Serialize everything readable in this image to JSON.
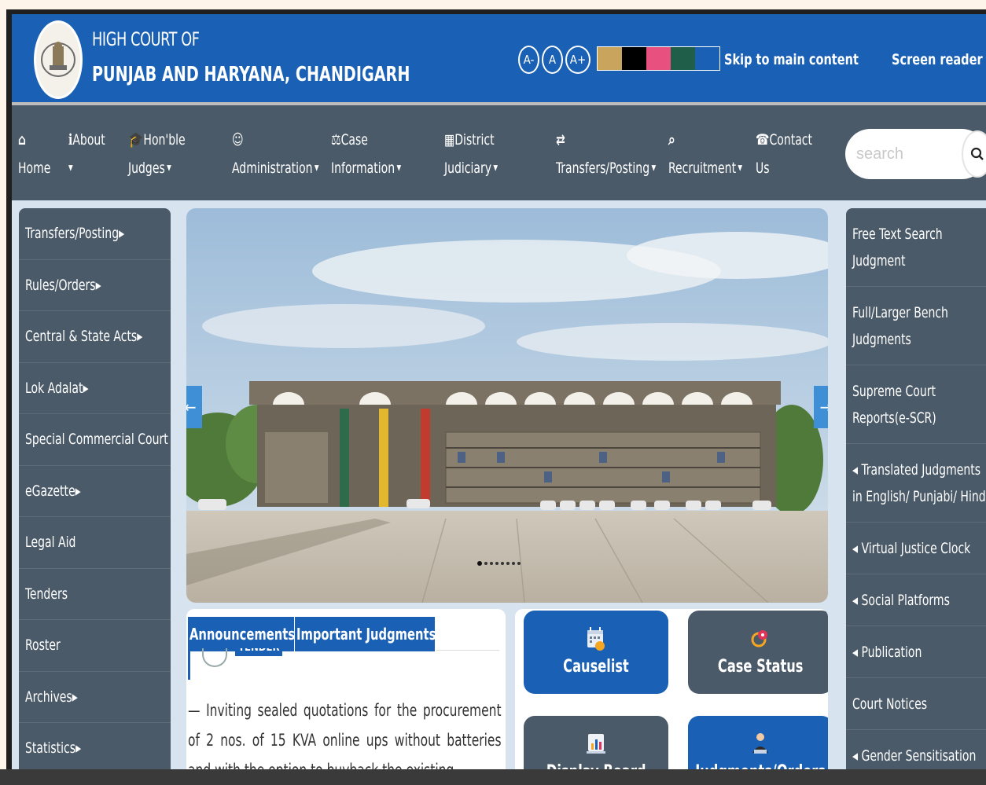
{
  "header": {
    "title_line1": "HIGH COURT OF",
    "title_line2": "PUNJAB AND HARYANA, CHANDIGARH",
    "font_controls": [
      "A-",
      "A",
      "A+"
    ],
    "theme_colors": [
      "#c9a45c",
      "#000000",
      "#e8507f",
      "#1f5f4a",
      "#1a60b4"
    ],
    "skip_link": "Skip to main content",
    "screen_reader": "Screen reader"
  },
  "nav": {
    "items": [
      {
        "icon": "home-icon",
        "line1": "",
        "line2": "Home",
        "caret": false
      },
      {
        "icon": "info-icon",
        "line1": "About",
        "line2": "",
        "caret": true
      },
      {
        "icon": "graduation-cap-icon",
        "line1": "Hon'ble",
        "line2": "Judges",
        "caret": true
      },
      {
        "icon": "user-icon",
        "line1": "",
        "line2": "Administration",
        "caret": true
      },
      {
        "icon": "scales-icon",
        "line1": "Case",
        "line2": "Information",
        "caret": true
      },
      {
        "icon": "building-icon",
        "line1": "District",
        "line2": "Judiciary",
        "caret": true
      },
      {
        "icon": "exchange-icon",
        "line1": "",
        "line2": "Transfers/Posting",
        "caret": true
      },
      {
        "icon": "search-icon",
        "line1": "",
        "line2": "Recruitment",
        "caret": true
      },
      {
        "icon": "phone-icon",
        "line1": "Contact",
        "line2": "Us",
        "caret": false
      }
    ],
    "search_placeholder": "search"
  },
  "left_menu": [
    "Transfers/Posting▸",
    "Rules/Orders▸",
    "Central & State Acts▸",
    "Lok Adalat▸",
    "Special Commercial Court",
    "eGazette▸",
    "Legal Aid",
    "Tenders",
    "Roster",
    "Archives▸",
    "Statistics▸"
  ],
  "right_menu": [
    {
      "line1": "Free Text Search",
      "line2": "Judgment"
    },
    {
      "line1": "Full/Larger Bench",
      "line2": "Judgments"
    },
    {
      "line1": "Supreme Court",
      "line2": "Reports(e-SCR)"
    },
    {
      "line1": "◂ Translated Judgments",
      "line2": "in English/ Punjabi/ Hindi"
    },
    {
      "line1": "◂ Virtual Justice Clock",
      "line2": ""
    },
    {
      "line1": "◂ Social Platforms",
      "line2": ""
    },
    {
      "line1": "◂ Publication",
      "line2": ""
    },
    {
      "line1": "Court Notices",
      "line2": ""
    },
    {
      "line1": "◂ Gender Sensitisation",
      "line2": ""
    }
  ],
  "news": {
    "tabs": [
      "Announcements",
      "Important Judgments"
    ],
    "tag": "TENDER",
    "text": "— Inviting sealed quotations for the procurement of 2 nos. of 15 KVA online ups without batteries and with the option to buyback the existing"
  },
  "tiles": [
    {
      "label": "Causelist",
      "icon": "calendar-clock-icon"
    },
    {
      "label": "Case Status",
      "icon": "case-status-icon"
    },
    {
      "label": "Display Board",
      "icon": "chart-board-icon"
    },
    {
      "label": "Judgments/Orders",
      "icon": "judge-icon"
    }
  ],
  "carousel": {
    "slides": 8,
    "active": 1
  }
}
